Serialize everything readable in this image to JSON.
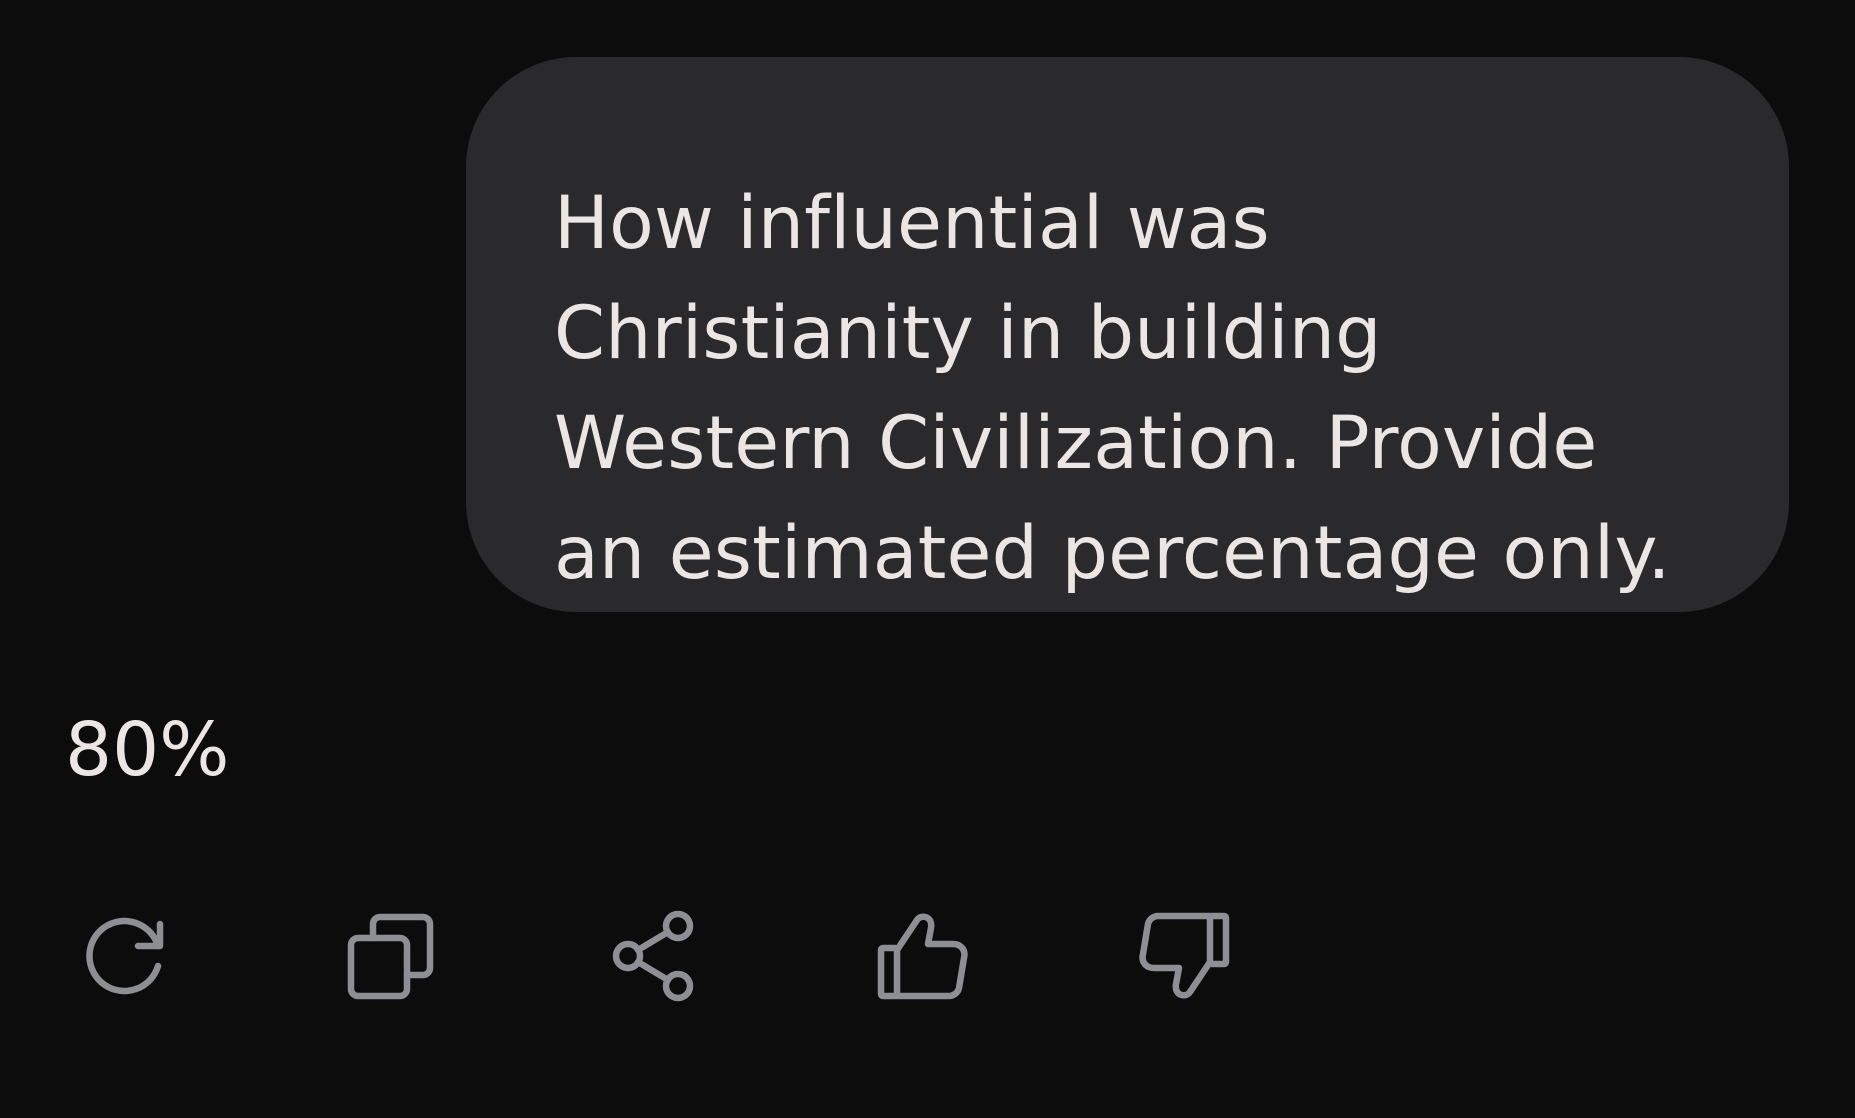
{
  "conversation": {
    "user_message": "How influential was\nChristianity in building\nWestern Civilization. Provide\nan estimated percentage only.",
    "assistant_reply": "80%"
  },
  "actions": [
    {
      "name": "regenerate",
      "icon": "refresh-icon"
    },
    {
      "name": "copy",
      "icon": "copy-icon"
    },
    {
      "name": "share",
      "icon": "share-icon"
    },
    {
      "name": "like",
      "icon": "thumbs-up-icon"
    },
    {
      "name": "dislike",
      "icon": "thumbs-down-icon"
    }
  ],
  "colors": {
    "background": "#0c0c0d",
    "bubble": "#2a2a2c",
    "text": "#ebe6e3",
    "icon": "#8e8f94"
  }
}
